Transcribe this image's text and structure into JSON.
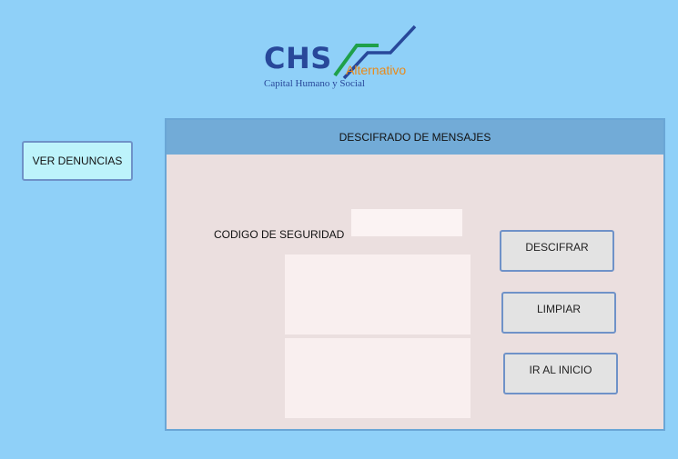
{
  "logo": {
    "primary": "CHS",
    "secondary": "Alternativo",
    "tagline": "Capital Humano y Social",
    "colors": {
      "primary": "#28489a",
      "secondary": "#e88a1a",
      "accent": "#1fa04a"
    }
  },
  "sidebar": {
    "ver_denuncias_label": "VER DENUNCIAS"
  },
  "panel": {
    "title": "DESCIFRADO DE MENSAJES",
    "code_label": "CODIGO DE SEGURIDAD",
    "code_value": "",
    "code_placeholder": "",
    "message_input_value": "",
    "message_output_value": ""
  },
  "actions": {
    "descifrar_label": "DESCIFRAR",
    "limpiar_label": "LIMPIAR",
    "inicio_label": "IR AL INICIO"
  },
  "theme": {
    "background": "#8fd0f8",
    "panel_header": "#72abd7",
    "panel_body": "#ebdfdf",
    "button_border": "#6f92c8"
  }
}
